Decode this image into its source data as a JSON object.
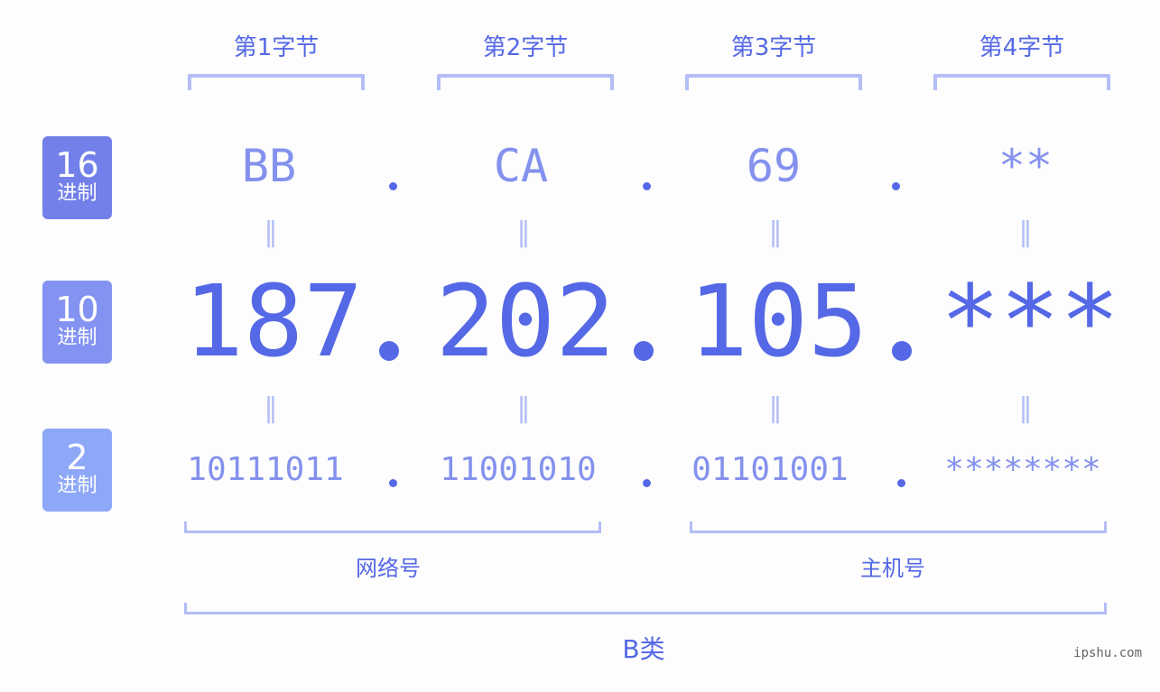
{
  "byte_headers": [
    "第1字节",
    "第2字节",
    "第3字节",
    "第4字节"
  ],
  "rows": {
    "hex": {
      "base": "16",
      "unit": "进制",
      "values": [
        "BB",
        "CA",
        "69",
        "**"
      ],
      "color": "#7480ea"
    },
    "dec": {
      "base": "10",
      "unit": "进制",
      "values": [
        "187",
        "202",
        "105",
        "***"
      ],
      "color": "#8493f1"
    },
    "bin": {
      "base": "2",
      "unit": "进制",
      "values": [
        "10111011",
        "11001010",
        "01101001",
        "********"
      ],
      "color": "#8ea8f8"
    }
  },
  "separator": ".",
  "equals": "=",
  "groups": {
    "network": "网络号",
    "host": "主机号",
    "class": "B类"
  },
  "watermark": "ipshu.com",
  "colors": {
    "accent": "#5568e6",
    "light": "#8491ee",
    "bracket": "#b3bdf6"
  }
}
